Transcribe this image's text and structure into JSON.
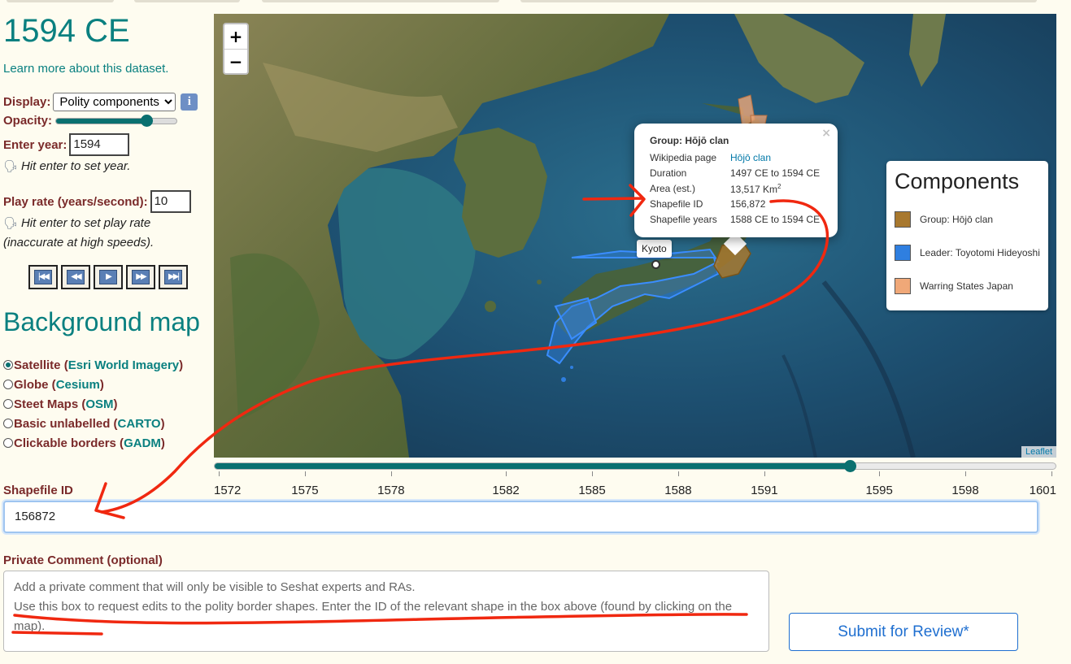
{
  "title": "1594 CE",
  "learn_more": "Learn more about this dataset.",
  "controls": {
    "display_label": "Display:",
    "display_value": "Polity components",
    "info_icon": "info-icon",
    "opacity_label": "Opacity:",
    "opacity_level": 0.75,
    "year_label": "Enter year:",
    "year_value": "1594",
    "year_hint": "Hit enter to set year.",
    "rate_label": "Play rate (years/second):",
    "rate_value": "10",
    "rate_hint_1": "Hit enter to set play rate",
    "rate_hint_2": "(inaccurate at high speeds).",
    "speaker_icon": "speaker-icon",
    "play_buttons": [
      "skip-to-start",
      "step-back",
      "play",
      "step-forward",
      "skip-to-end"
    ]
  },
  "background_map": {
    "heading": "Background map",
    "options": [
      {
        "name": "Satellite",
        "source": "Esri World Imagery",
        "selected": true
      },
      {
        "name": "Globe",
        "source": "Cesium",
        "selected": false
      },
      {
        "name": "Steet Maps",
        "source": "OSM",
        "selected": false
      },
      {
        "name": "Basic unlabelled",
        "source": "CARTO",
        "selected": false
      },
      {
        "name": "Clickable borders",
        "source": "GADM",
        "selected": false
      }
    ]
  },
  "map": {
    "zoom_in": "+",
    "zoom_out": "−",
    "popup": {
      "close": "×",
      "title": "Group: Hōjō clan",
      "rows": [
        {
          "key": "Wikipedia page",
          "value": "Hōjō clan",
          "link": true
        },
        {
          "key": "Duration",
          "value": "1497 CE to 1594 CE"
        },
        {
          "key": "Area (est.)",
          "value": "13,517 Km",
          "sup": "2"
        },
        {
          "key": "Shapefile ID",
          "value": "156,872"
        },
        {
          "key": "Shapefile years",
          "value": "1588 CE to 1594 CE"
        }
      ]
    },
    "marker_label": "Kyoto",
    "legend": {
      "title": "Components",
      "items": [
        {
          "label": "Group: Hōjō clan",
          "color": "#a8782e"
        },
        {
          "label": "Leader: Toyotomi Hideyoshi",
          "color": "#2f7fe0"
        },
        {
          "label": "Warring States Japan",
          "color": "#f0a878"
        }
      ]
    },
    "attribution": "Leaflet"
  },
  "timeline": {
    "ticks": [
      "1572",
      "1575",
      "1578",
      "1582",
      "1585",
      "1588",
      "1591",
      "1595",
      "1598",
      "1601"
    ],
    "tick_values": [
      1572,
      1575,
      1578,
      1582,
      1585,
      1588,
      1591,
      1595,
      1598,
      1601
    ],
    "range": [
      1572,
      1601
    ],
    "current_year": 1594
  },
  "form": {
    "shapefile_label": "Shapefile ID",
    "shapefile_value": "156872",
    "comment_label": "Private Comment (optional)",
    "comment_placeholder": "Add a private comment that will only be visible to Seshat experts and RAs.\nUse this box to request edits to the polity border shapes. Enter the ID of the relevant shape in the box above (found by clicking on the map).",
    "submit_label": "Submit for Review*"
  },
  "colors": {
    "accent_teal": "#0a8080",
    "label_red": "#7a2a2a",
    "annotation_red": "#f02810",
    "page_bg": "#fefcf0"
  }
}
